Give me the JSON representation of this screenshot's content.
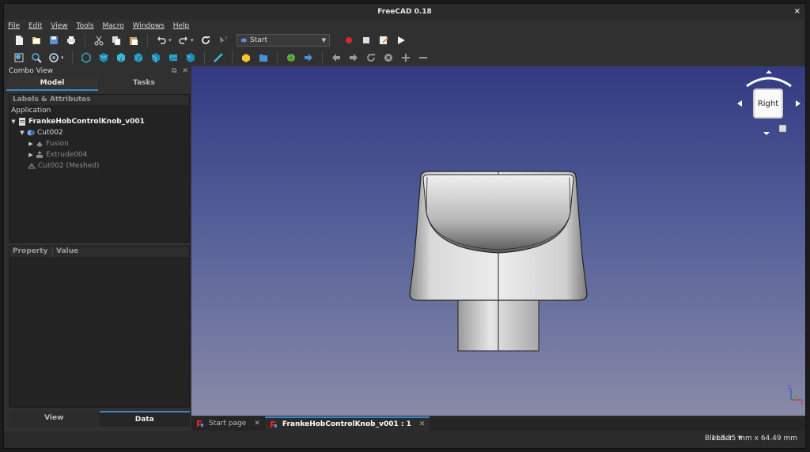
{
  "window": {
    "title": "FreeCAD 0.18",
    "close_glyph": "×"
  },
  "menu": [
    "File",
    "Edit",
    "View",
    "Tools",
    "Macro",
    "Windows",
    "Help"
  ],
  "toolbar": {
    "workbench": "Start"
  },
  "combo": {
    "title": "Combo View",
    "tabs": [
      "Model",
      "Tasks"
    ],
    "tree_header": "Labels & Attributes",
    "application_label": "Application",
    "items": [
      {
        "label": "FrankeHobControlKnob_v001",
        "icon": "document-icon"
      },
      {
        "label": "Cut002",
        "icon": "cut-icon"
      },
      {
        "label": "Fusion",
        "icon": "fusion-icon"
      },
      {
        "label": "Extrude004",
        "icon": "extrude-icon"
      },
      {
        "label": "Cut002 (Meshed)",
        "icon": "mesh-icon"
      }
    ],
    "property_headers": [
      "Property",
      "Value"
    ],
    "bottom_tabs": [
      "View",
      "Data"
    ]
  },
  "navcube": {
    "face": "Right"
  },
  "doc_tabs": [
    {
      "label": "Start page"
    },
    {
      "label": "FrankeHobControlKnob_v001 : 1"
    }
  ],
  "status": {
    "navigation": "Blender",
    "dimensions": "113.35 mm x 64.49 mm"
  },
  "colors": {
    "accent": "#3d85c6",
    "bg_top": "#333a82",
    "bg_bottom": "#898aa8"
  }
}
